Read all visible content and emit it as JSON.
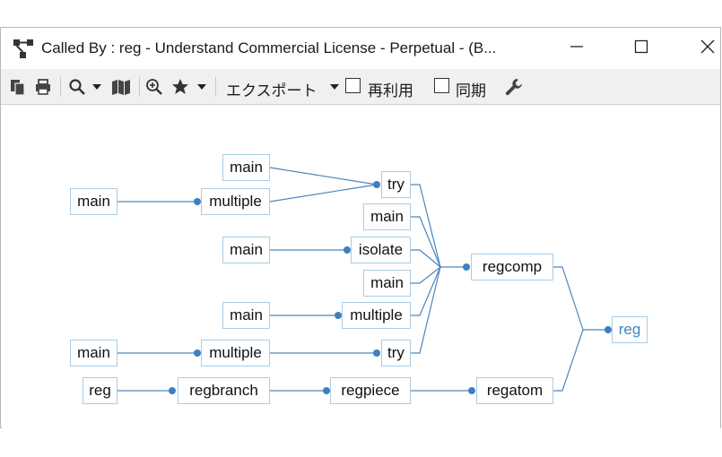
{
  "window": {
    "title": "Called By : reg - Understand Commercial License - Perpetual - (B...",
    "icons": {
      "app": "graph-tree-icon",
      "minimize": "minimize-icon",
      "maximize": "maximize-icon",
      "close": "close-icon"
    }
  },
  "toolbar": {
    "export_label": "エクスポート",
    "reuse_label": "再利用",
    "reuse_checked": false,
    "sync_label": "同期",
    "sync_checked": false,
    "icons": [
      "copy-icon",
      "print-icon",
      "search-icon",
      "dropdown-arrow-icon",
      "map-icon",
      "zoom-icon",
      "star-icon",
      "dropdown-arrow-icon",
      "dropdown-arrow-icon",
      "wrench-icon"
    ]
  },
  "graph": {
    "edge_color": "#4a86be",
    "node_border_color": "#a9cde6",
    "root_text_color": "#3d86c6",
    "nodes": {
      "n_main_1": "main",
      "n_main_2": "main",
      "n_multiple_1": "multiple",
      "n_try_1": "try",
      "n_main_3": "main",
      "n_main_4": "main",
      "n_isolate": "isolate",
      "n_main_5": "main",
      "n_main_6": "main",
      "n_multiple_2": "multiple",
      "n_main_7": "main",
      "n_multiple_3": "multiple",
      "n_try_2": "try",
      "n_reg_leaf": "reg",
      "n_regbranch": "regbranch",
      "n_regpiece": "regpiece",
      "n_regcomp": "regcomp",
      "n_regatom": "regatom",
      "n_reg_root": "reg"
    }
  }
}
